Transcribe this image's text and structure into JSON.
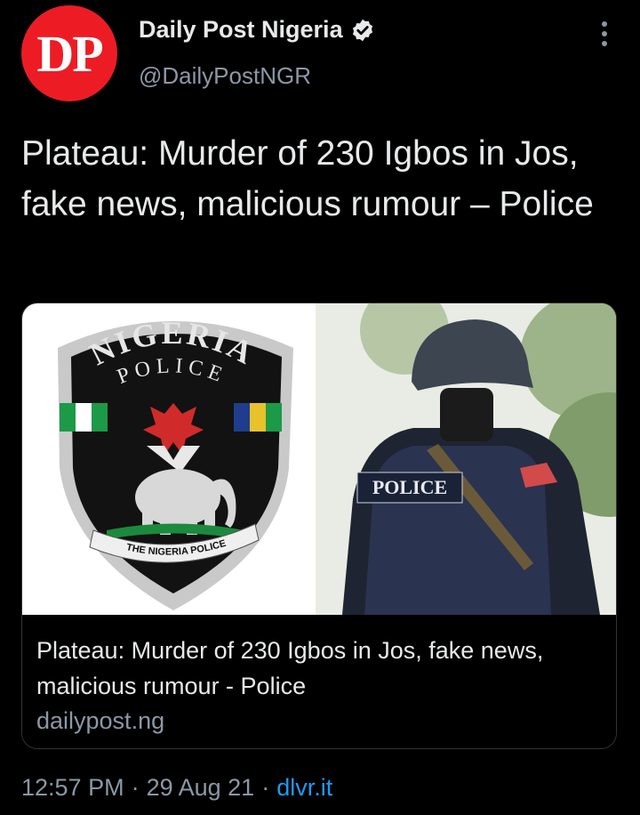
{
  "account": {
    "avatar_text": "DP",
    "display_name": "Daily Post Nigeria",
    "handle": "@DailyPostNGR",
    "verified": true,
    "avatar_color": "#ed1c24"
  },
  "tweet": {
    "text": "Plateau: Murder of 230 Igbos in Jos, fake news, malicious rumour – Police"
  },
  "link_card": {
    "image": {
      "badge_arc_text": "NIGERIA",
      "badge_sub_text": "POLICE",
      "badge_ribbon_text": "THE NIGERIA POLICE",
      "vest_text": "POLICE"
    },
    "title": "Plateau: Murder of 230 Igbos in Jos, fake news, malicious rumour - Police",
    "domain": "dailypost.ng"
  },
  "meta": {
    "time": "12:57 PM",
    "date": "29 Aug 21",
    "source": "dlvr.it",
    "separator": "·"
  },
  "colors": {
    "link": "#1d9bf0",
    "secondary_text": "#8b98a5",
    "verified_badge": "#e7e9ea"
  }
}
